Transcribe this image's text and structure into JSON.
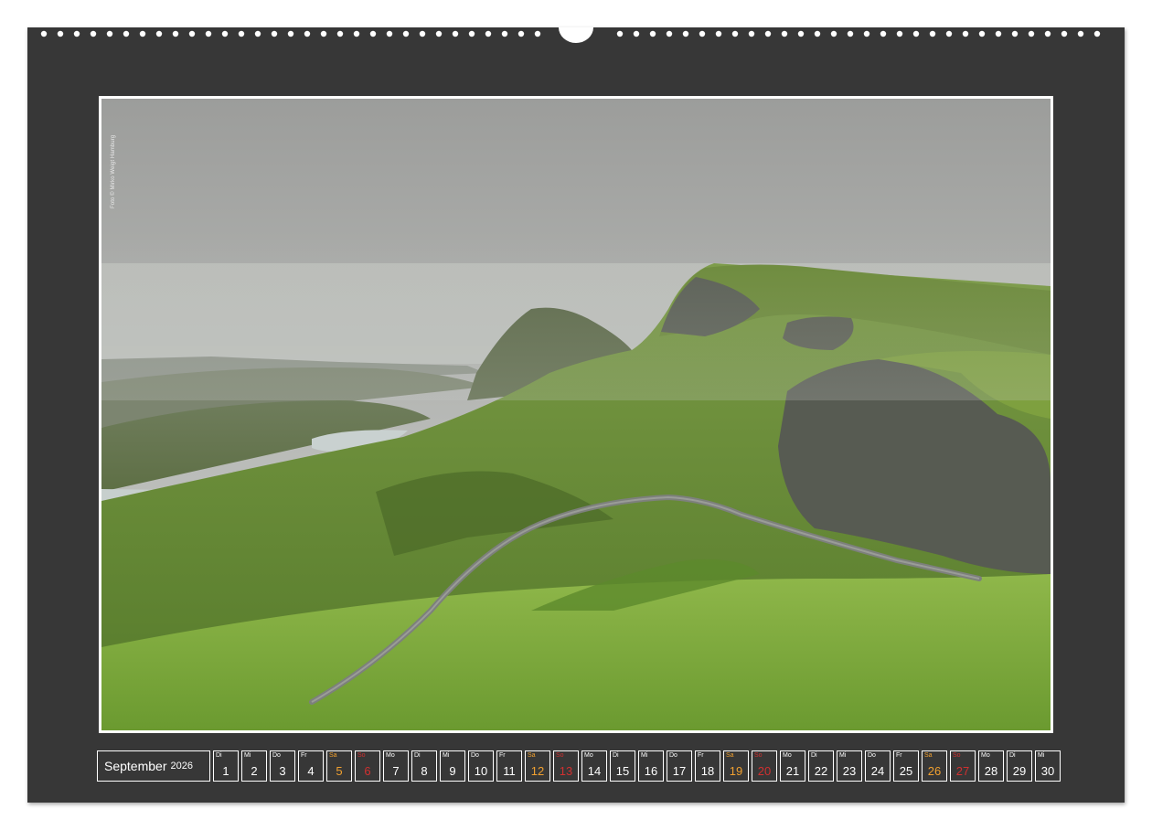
{
  "page": {
    "credit": "Foto © Mirko Weigt Hamburg",
    "colors": {
      "frame": "#373737",
      "saturday": "#f0a030",
      "sunday": "#d03030"
    }
  },
  "calendar": {
    "month": "September",
    "year": "2026",
    "days": [
      {
        "abbr": "Di",
        "num": "1",
        "kind": "weekday"
      },
      {
        "abbr": "Mi",
        "num": "2",
        "kind": "weekday"
      },
      {
        "abbr": "Do",
        "num": "3",
        "kind": "weekday"
      },
      {
        "abbr": "Fr",
        "num": "4",
        "kind": "weekday"
      },
      {
        "abbr": "Sa",
        "num": "5",
        "kind": "sat"
      },
      {
        "abbr": "So",
        "num": "6",
        "kind": "sun"
      },
      {
        "abbr": "Mo",
        "num": "7",
        "kind": "weekday"
      },
      {
        "abbr": "Di",
        "num": "8",
        "kind": "weekday"
      },
      {
        "abbr": "Mi",
        "num": "9",
        "kind": "weekday"
      },
      {
        "abbr": "Do",
        "num": "10",
        "kind": "weekday"
      },
      {
        "abbr": "Fr",
        "num": "11",
        "kind": "weekday"
      },
      {
        "abbr": "Sa",
        "num": "12",
        "kind": "sat"
      },
      {
        "abbr": "So",
        "num": "13",
        "kind": "sun"
      },
      {
        "abbr": "Mo",
        "num": "14",
        "kind": "weekday"
      },
      {
        "abbr": "Di",
        "num": "15",
        "kind": "weekday"
      },
      {
        "abbr": "Mi",
        "num": "16",
        "kind": "weekday"
      },
      {
        "abbr": "Do",
        "num": "17",
        "kind": "weekday"
      },
      {
        "abbr": "Fr",
        "num": "18",
        "kind": "weekday"
      },
      {
        "abbr": "Sa",
        "num": "19",
        "kind": "sat"
      },
      {
        "abbr": "So",
        "num": "20",
        "kind": "sun"
      },
      {
        "abbr": "Mo",
        "num": "21",
        "kind": "weekday"
      },
      {
        "abbr": "Di",
        "num": "22",
        "kind": "weekday"
      },
      {
        "abbr": "Mi",
        "num": "23",
        "kind": "weekday"
      },
      {
        "abbr": "Do",
        "num": "24",
        "kind": "weekday"
      },
      {
        "abbr": "Fr",
        "num": "25",
        "kind": "weekday"
      },
      {
        "abbr": "Sa",
        "num": "26",
        "kind": "sat"
      },
      {
        "abbr": "So",
        "num": "27",
        "kind": "sun"
      },
      {
        "abbr": "Mo",
        "num": "28",
        "kind": "weekday"
      },
      {
        "abbr": "Di",
        "num": "29",
        "kind": "weekday"
      },
      {
        "abbr": "Mi",
        "num": "30",
        "kind": "weekday"
      }
    ]
  }
}
